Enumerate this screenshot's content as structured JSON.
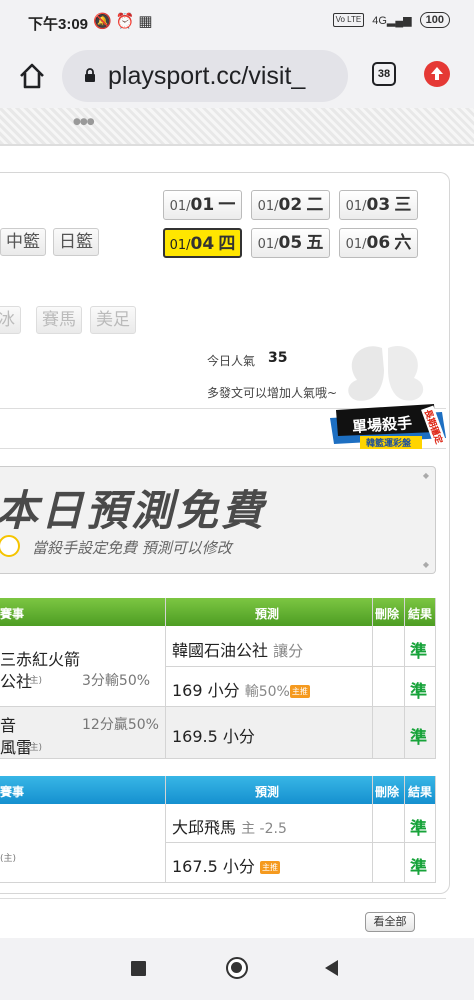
{
  "status": {
    "time": "下午3:09",
    "network": "4G",
    "volte": "Vo LTE",
    "battery": "100"
  },
  "browser": {
    "url": "playsport.cc/visit_",
    "tab_count": "38"
  },
  "sports": [
    "中籃",
    "日籃"
  ],
  "sports_faded": [
    "冰",
    "賽馬",
    "美足"
  ],
  "dates": [
    {
      "date": "01/",
      "num": "01",
      "day": "一"
    },
    {
      "date": "01/",
      "num": "02",
      "day": "二"
    },
    {
      "date": "01/",
      "num": "03",
      "day": "三"
    },
    {
      "date": "01/",
      "num": "04",
      "day": "四"
    },
    {
      "date": "01/",
      "num": "05",
      "day": "五"
    },
    {
      "date": "01/",
      "num": "06",
      "day": "六"
    }
  ],
  "popularity": {
    "label": "今日人氣",
    "value": "35",
    "hint": "多發文可以增加人氣哦~"
  },
  "killer_badge": {
    "main": "單場殺手",
    "sub": "韓籃運彩盤",
    "ribbon": "長期穩定"
  },
  "free_banner": {
    "title": "本日預測免費",
    "subtitle": "當殺手設定免費 預測可以修改"
  },
  "table1": {
    "headers": {
      "event": "賽事",
      "prediction": "預測",
      "delete": "刪除",
      "result": "結果"
    },
    "rows": [
      {
        "team1": "三赤紅火箭",
        "team2": "公社",
        "home": "(主)",
        "record": "3分輸50%",
        "pred1": "韓國石油公社",
        "pred1_extra": "讓分",
        "result1": "準",
        "pred2": "169 小分",
        "pred2_extra": "輸50%",
        "tag": "主推",
        "result2": "準"
      },
      {
        "team1": "音",
        "team2": "風雷",
        "home": "(主)",
        "record": "12分贏50%",
        "pred": "169.5 小分",
        "result": "準"
      }
    ]
  },
  "table2": {
    "headers": {
      "event": "賽事",
      "prediction": "預測",
      "delete": "刪除",
      "result": "結果"
    },
    "rows": [
      {
        "home": "(主)",
        "pred1": "大邱飛馬",
        "pred1_extra": "主 -2.5",
        "result1": "準",
        "pred2": "167.5 小分",
        "tag": "主推",
        "result2": "準"
      }
    ]
  },
  "see_all": "看全部"
}
